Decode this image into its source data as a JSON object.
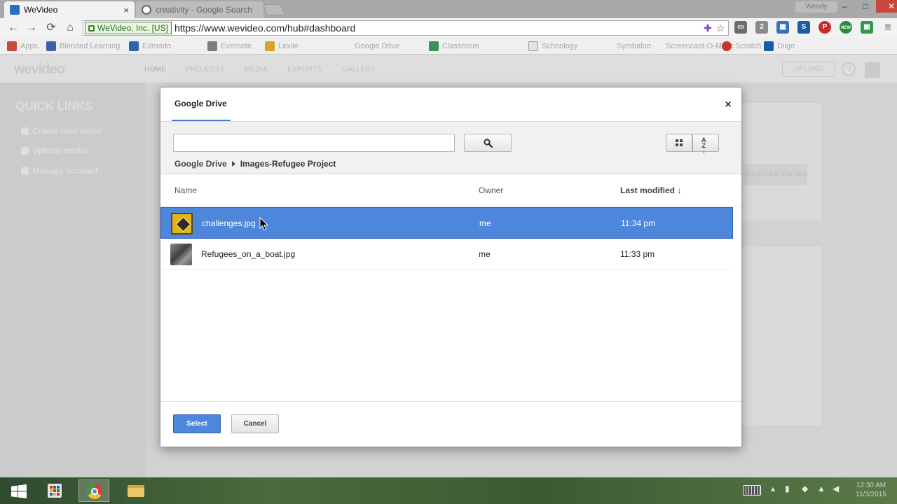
{
  "browser": {
    "tabs": [
      {
        "title": "WeVideo",
        "close": "×",
        "active": true
      },
      {
        "title": "creativity - Google Search",
        "active": false
      }
    ],
    "window_controls": {
      "user": "Wendy",
      "minimize": "–",
      "maximize": "□",
      "close": "✕"
    },
    "security_badge": "WeVideo, Inc. [US]",
    "url": "https://www.wevideo.com/hub#dashboard",
    "bookmarks": [
      "Apps",
      "Blended Learning",
      "Edmodo",
      "Evernote",
      "Lexile",
      "Google Drive",
      "Classroom",
      "Schoology",
      "Symbaloo",
      "Screencast-O-Matic",
      "Scratch",
      "Diigo"
    ],
    "extension_badge_new": "NEW",
    "extension_badge_count": "2"
  },
  "wevideo": {
    "logo": "wevideo",
    "nav": [
      "HOME",
      "PROJECTS",
      "MEDIA",
      "EXPORTS",
      "GALLERY"
    ],
    "upload": "UPLOAD",
    "quick_links_title": "QUICK LINKS",
    "quick_links": [
      "Create new video",
      "Upload media",
      "Manage account"
    ],
    "bg_button": "CONTINUE EDITING"
  },
  "dialog": {
    "title": "Google Drive",
    "close": "×",
    "search_placeholder": "",
    "breadcrumb": [
      "Google Drive",
      "Images-Refugee Project"
    ],
    "columns": {
      "name": "Name",
      "owner": "Owner",
      "modified": "Last modified ↓"
    },
    "files": [
      {
        "name": "challenges.jpg",
        "owner": "me",
        "modified": "11:34 pm",
        "selected": true
      },
      {
        "name": "Refugees_on_a_boat.jpg",
        "owner": "me",
        "modified": "11:33 pm",
        "selected": false
      }
    ],
    "select_label": "Select",
    "cancel_label": "Cancel"
  },
  "taskbar": {
    "time": "12:30 AM",
    "date": "11/3/2015"
  },
  "colors": {
    "accent": "#4d86db",
    "accent_border": "#2c5fb8",
    "overlay_page": "#d2d2d2"
  }
}
